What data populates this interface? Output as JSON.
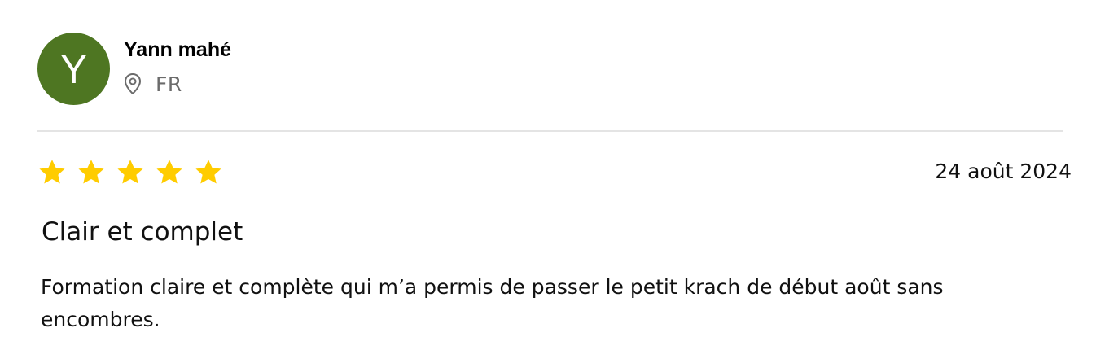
{
  "author": {
    "initial": "Y",
    "name": "Yann mahé",
    "country": "FR",
    "avatar_color": "#4e7622",
    "location_icon": "map-pin-icon"
  },
  "review": {
    "rating": 5,
    "rating_max": 5,
    "star_color": "#ffcc00",
    "date": "24 août 2024",
    "title": "Clair et complet",
    "body": "Formation claire et complète qui m’a permis de passer le petit krach de début août sans encombres."
  }
}
